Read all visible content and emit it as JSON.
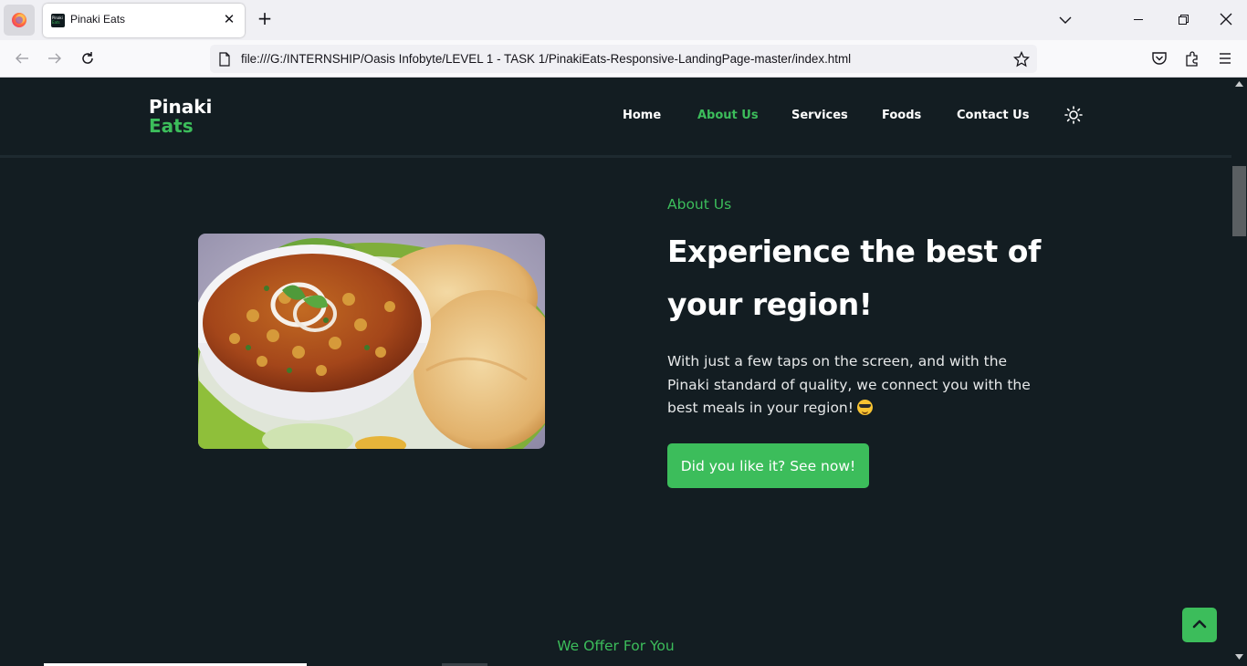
{
  "browser": {
    "tab_title": "Pinaki Eats",
    "tab_favicon": {
      "line1": "Pinaki",
      "line2": "Eats"
    },
    "url": "file:///G:/INTERNSHIP/Oasis Infobyte/LEVEL 1 - TASK 1/PinakiEats-Responsive-LandingPage-master/index.html",
    "close_glyph": "✕",
    "new_tab_glyph": "+"
  },
  "site": {
    "logo_line1": "Pinaki",
    "logo_line2": "Eats",
    "nav": [
      {
        "label": "Home",
        "active": false
      },
      {
        "label": "About Us",
        "active": true
      },
      {
        "label": "Services",
        "active": false
      },
      {
        "label": "Foods",
        "active": false
      },
      {
        "label": "Contact Us",
        "active": false
      }
    ],
    "theme_toggle_icon": "sun-icon"
  },
  "about": {
    "kicker": "About Us",
    "title": "Experience the best of your region!",
    "description": "With just a few taps on the screen, and with the Pinaki standard of quality, we connect you with the best meals in your region!",
    "cta_label": "Did you like it? See now!",
    "image_alt": "Chole bhature dish"
  },
  "offer": {
    "heading": "We Offer For You"
  },
  "colors": {
    "accent": "#3cbd5b",
    "background": "#131d22",
    "text": "#ffffff"
  }
}
